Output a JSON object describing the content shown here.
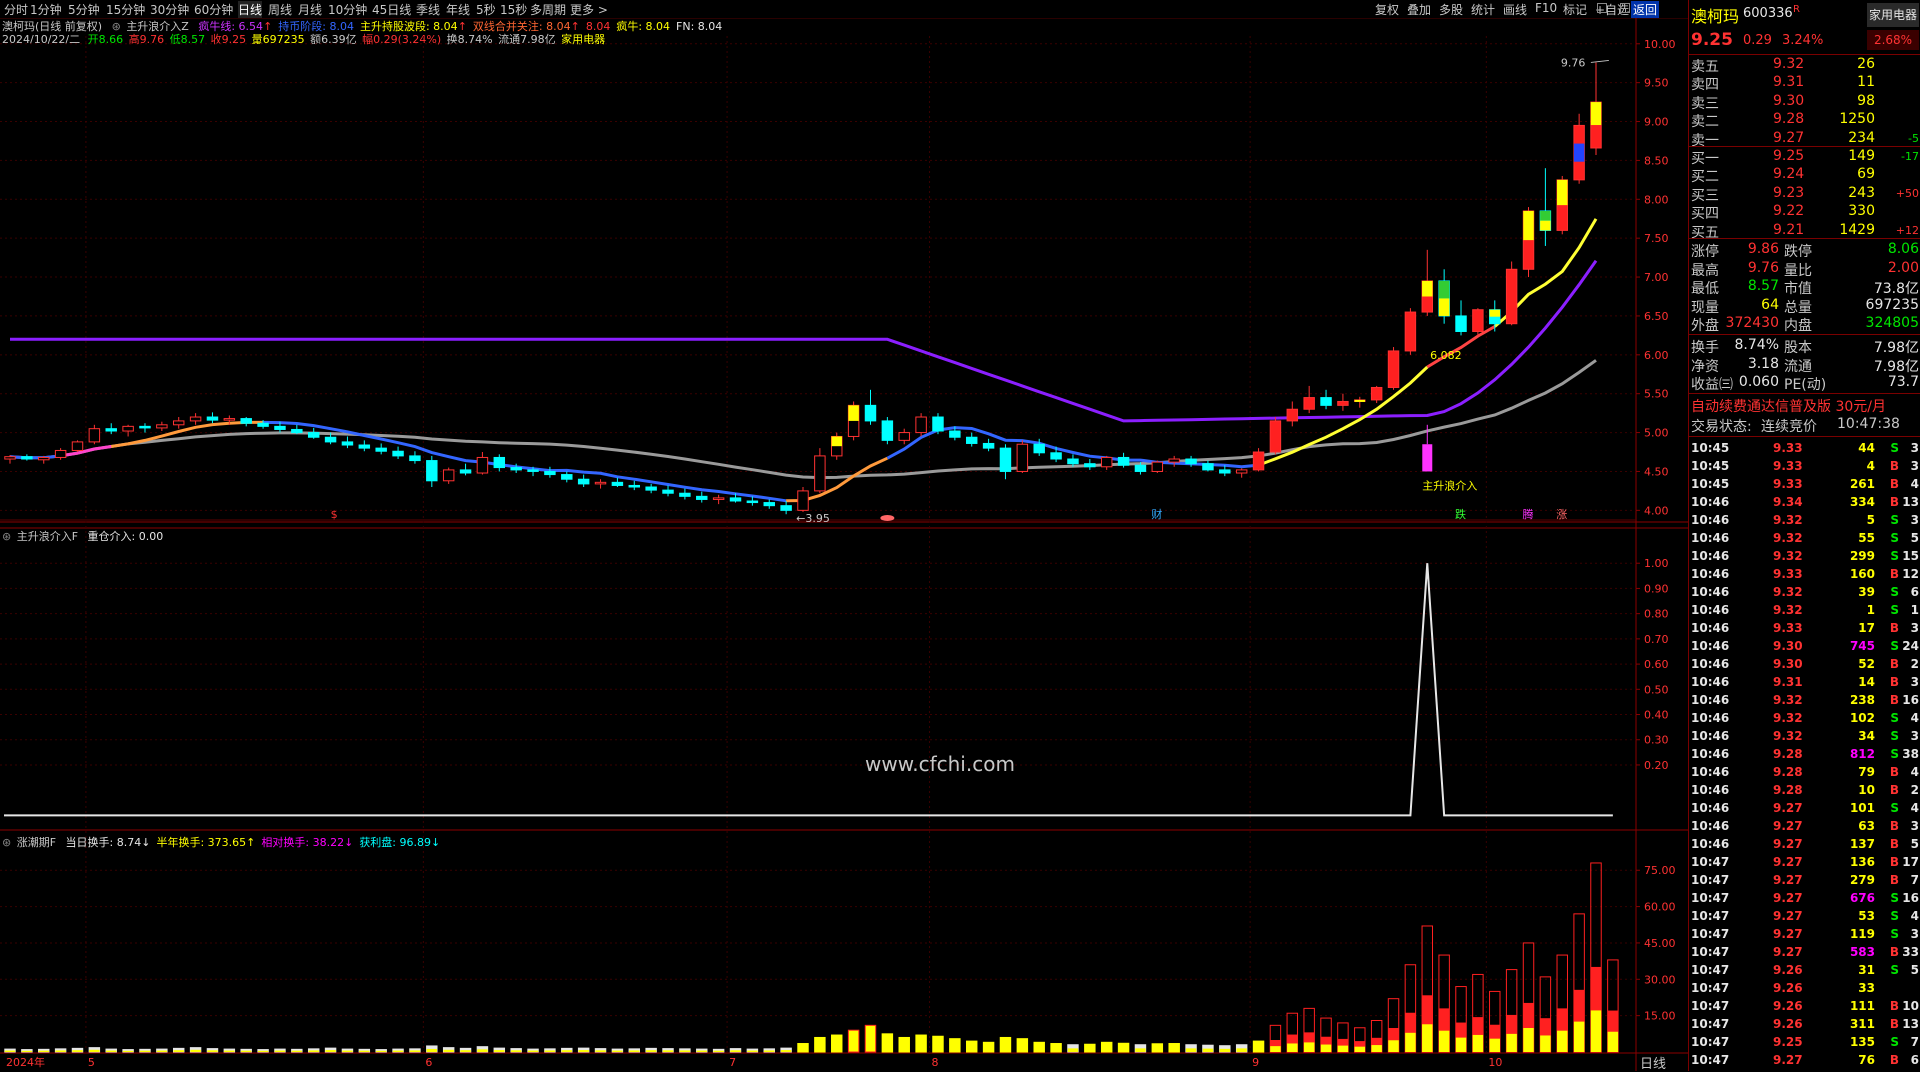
{
  "topbar": {
    "periods": [
      "分时",
      "1分钟",
      "5分钟",
      "15分钟",
      "30分钟",
      "60分钟",
      "日线",
      "周线",
      "月线",
      "10分钟",
      "45日线",
      "季线",
      "年线",
      "5秒",
      "15秒",
      "多周期",
      "更多 >"
    ],
    "active_period": "日线",
    "right_buttons": [
      "复权",
      "叠加",
      "多股",
      "统计",
      "画线",
      "F10",
      "标记",
      "+自选",
      "返回"
    ]
  },
  "main_legend": {
    "stock_title": "澳柯玛(日线 前复权)",
    "indicator_name": "主升浪介入Z",
    "items": [
      {
        "label": "疯牛线: 6.54",
        "color": "#cc33ff"
      },
      {
        "label": "持币阶段: 8.04",
        "color": "#3366ff"
      },
      {
        "label": "主升持股波段: 8.04",
        "color": "#ffff00"
      },
      {
        "label": "双线合并关注: 8.04",
        "color": "#ff6633"
      },
      {
        "label": "8.04",
        "color": "#ff3232"
      },
      {
        "label": "疯牛: 8.04",
        "color": "#ffff00"
      },
      {
        "label": "FN: 8.04",
        "color": "#e6e6e6"
      }
    ]
  },
  "quote_line": {
    "date": "2024/10/22/二",
    "open": "开8.66",
    "high": "高9.76",
    "low": "低8.57",
    "close": "收9.25",
    "vol": "量697235",
    "amount": "额6.39亿",
    "amp": "幅0.29(3.24%)",
    "turnover": "换8.74%",
    "float_cap": "流通7.98亿",
    "sector": "家用电器"
  },
  "chart_data": [
    {
      "type": "candlestick",
      "title": "澳柯玛(日线 前复权)",
      "y_ticks": [
        "10.00",
        "9.50",
        "9.00",
        "8.50",
        "8.00",
        "7.50",
        "7.00",
        "6.50",
        "6.00",
        "5.50",
        "5.00",
        "4.50",
        "4.00"
      ],
      "ylim": [
        3.85,
        10.1
      ],
      "annotations": [
        "9.76",
        "3.95",
        "6.082",
        "主升浪介入"
      ],
      "markers": [
        "$",
        "财",
        "跌",
        "腾",
        "涨"
      ],
      "x_month_labels": [
        "2024年",
        "5",
        "6",
        "7",
        "8",
        "9",
        "10"
      ],
      "candles": [
        [
          4.66,
          4.71,
          4.6,
          4.69
        ],
        [
          4.69,
          4.72,
          4.64,
          4.66
        ],
        [
          4.65,
          4.7,
          4.6,
          4.68
        ],
        [
          4.68,
          4.8,
          4.65,
          4.77
        ],
        [
          4.77,
          4.9,
          4.75,
          4.88
        ],
        [
          4.88,
          5.1,
          4.85,
          5.05
        ],
        [
          5.05,
          5.12,
          4.98,
          5.02
        ],
        [
          5.02,
          5.1,
          4.95,
          5.08
        ],
        [
          5.08,
          5.12,
          5.0,
          5.06
        ],
        [
          5.06,
          5.14,
          5.02,
          5.1
        ],
        [
          5.1,
          5.2,
          5.05,
          5.15
        ],
        [
          5.15,
          5.25,
          5.1,
          5.2
        ],
        [
          5.2,
          5.26,
          5.12,
          5.16
        ],
        [
          5.16,
          5.22,
          5.1,
          5.18
        ],
        [
          5.18,
          5.2,
          5.08,
          5.12
        ],
        [
          5.12,
          5.16,
          5.05,
          5.08
        ],
        [
          5.08,
          5.14,
          5.0,
          5.04
        ],
        [
          5.04,
          5.1,
          4.98,
          5.0
        ],
        [
          5.0,
          5.06,
          4.92,
          4.94
        ],
        [
          4.94,
          5.0,
          4.85,
          4.88
        ],
        [
          4.88,
          4.95,
          4.8,
          4.84
        ],
        [
          4.84,
          4.9,
          4.76,
          4.8
        ],
        [
          4.8,
          4.86,
          4.72,
          4.76
        ],
        [
          4.76,
          4.82,
          4.66,
          4.7
        ],
        [
          4.7,
          4.76,
          4.6,
          4.64
        ],
        [
          4.64,
          4.7,
          4.3,
          4.38
        ],
        [
          4.38,
          4.55,
          4.34,
          4.52
        ],
        [
          4.52,
          4.6,
          4.45,
          4.48
        ],
        [
          4.48,
          4.75,
          4.46,
          4.68
        ],
        [
          4.68,
          4.72,
          4.5,
          4.55
        ],
        [
          4.55,
          4.6,
          4.48,
          4.52
        ],
        [
          4.52,
          4.56,
          4.44,
          4.5
        ],
        [
          4.5,
          4.56,
          4.42,
          4.46
        ],
        [
          4.46,
          4.5,
          4.36,
          4.4
        ],
        [
          4.4,
          4.46,
          4.3,
          4.34
        ],
        [
          4.34,
          4.4,
          4.28,
          4.36
        ],
        [
          4.36,
          4.42,
          4.3,
          4.32
        ],
        [
          4.32,
          4.38,
          4.26,
          4.3
        ],
        [
          4.3,
          4.34,
          4.22,
          4.26
        ],
        [
          4.26,
          4.32,
          4.18,
          4.22
        ],
        [
          4.22,
          4.28,
          4.14,
          4.18
        ],
        [
          4.18,
          4.24,
          4.1,
          4.14
        ],
        [
          4.14,
          4.2,
          4.08,
          4.16
        ],
        [
          4.16,
          4.22,
          4.1,
          4.12
        ],
        [
          4.12,
          4.18,
          4.06,
          4.1
        ],
        [
          4.1,
          4.14,
          4.02,
          4.06
        ],
        [
          4.06,
          4.12,
          3.95,
          4.0
        ],
        [
          4.0,
          4.3,
          3.98,
          4.25
        ],
        [
          4.25,
          4.8,
          4.22,
          4.7
        ],
        [
          4.7,
          5.0,
          4.65,
          4.95
        ],
        [
          4.95,
          5.4,
          4.9,
          5.35
        ],
        [
          5.35,
          5.55,
          5.1,
          5.15
        ],
        [
          5.15,
          5.2,
          4.85,
          4.9
        ],
        [
          4.9,
          5.05,
          4.85,
          5.0
        ],
        [
          5.0,
          5.25,
          4.95,
          5.2
        ],
        [
          5.2,
          5.25,
          4.98,
          5.02
        ],
        [
          5.02,
          5.08,
          4.9,
          4.94
        ],
        [
          4.94,
          5.0,
          4.82,
          4.86
        ],
        [
          4.86,
          4.92,
          4.76,
          4.8
        ],
        [
          4.8,
          4.85,
          4.4,
          4.5
        ],
        [
          4.5,
          4.9,
          4.48,
          4.85
        ],
        [
          4.85,
          4.92,
          4.7,
          4.74
        ],
        [
          4.74,
          4.82,
          4.62,
          4.66
        ],
        [
          4.66,
          4.72,
          4.56,
          4.6
        ],
        [
          4.6,
          4.66,
          4.52,
          4.56
        ],
        [
          4.56,
          4.7,
          4.52,
          4.68
        ],
        [
          4.68,
          4.74,
          4.55,
          4.58
        ],
        [
          4.58,
          4.62,
          4.46,
          4.5
        ],
        [
          4.5,
          4.64,
          4.48,
          4.62
        ],
        [
          4.62,
          4.7,
          4.56,
          4.66
        ],
        [
          4.66,
          4.7,
          4.56,
          4.6
        ],
        [
          4.6,
          4.64,
          4.5,
          4.52
        ],
        [
          4.52,
          4.58,
          4.44,
          4.48
        ],
        [
          4.48,
          4.54,
          4.42,
          4.52
        ],
        [
          4.52,
          4.8,
          4.5,
          4.75
        ],
        [
          4.75,
          5.2,
          4.72,
          5.15
        ],
        [
          5.15,
          5.4,
          5.08,
          5.3
        ],
        [
          5.3,
          5.6,
          5.25,
          5.45
        ],
        [
          5.45,
          5.55,
          5.3,
          5.35
        ],
        [
          5.35,
          5.5,
          5.28,
          5.4
        ],
        [
          5.4,
          5.46,
          5.32,
          5.42
        ],
        [
          5.42,
          5.6,
          5.38,
          5.58
        ],
        [
          5.58,
          6.1,
          5.55,
          6.05
        ],
        [
          6.05,
          6.6,
          6.0,
          6.55
        ],
        [
          6.55,
          7.35,
          6.5,
          6.95
        ],
        [
          6.95,
          7.1,
          6.4,
          6.5
        ],
        [
          6.5,
          6.7,
          6.25,
          6.3
        ],
        [
          6.3,
          6.6,
          6.25,
          6.58
        ],
        [
          6.58,
          6.7,
          6.3,
          6.4
        ],
        [
          6.4,
          7.2,
          6.38,
          7.1
        ],
        [
          7.1,
          7.9,
          7.0,
          7.85
        ],
        [
          7.85,
          8.4,
          7.4,
          7.6
        ],
        [
          7.6,
          8.3,
          7.55,
          8.25
        ],
        [
          8.25,
          9.1,
          8.2,
          8.95
        ],
        [
          8.66,
          9.76,
          8.57,
          9.25
        ]
      ]
    },
    {
      "type": "line",
      "title": "主升浪介入F",
      "legend": "重仓介入: 0.00",
      "y_ticks": [
        "1.00",
        "0.90",
        "0.80",
        "0.70",
        "0.60",
        "0.50",
        "0.40",
        "0.30",
        "0.20"
      ],
      "ylim": [
        -0.05,
        1.1
      ],
      "series": [
        {
          "name": "重仓介入",
          "spike_index": 84,
          "values": [
            0,
            1,
            0
          ]
        }
      ]
    },
    {
      "type": "bar",
      "title": "涨潮期F",
      "legend": [
        {
          "label": "当日换手: 8.74↓",
          "color": "#e6e6e6"
        },
        {
          "label": "半年换手: 373.65↑",
          "color": "#ffff00"
        },
        {
          "label": "相对换手: 38.22↓",
          "color": "#ff00ff"
        },
        {
          "label": "获利盘: 96.89↓",
          "color": "#00ffff"
        }
      ],
      "y_ticks": [
        "75.00",
        "60.00",
        "45.00",
        "30.00",
        "15.00"
      ],
      "ylim": [
        0,
        85
      ],
      "values": [
        1.2,
        1.0,
        1.1,
        1.3,
        1.5,
        1.8,
        1.2,
        1.0,
        1.1,
        1.2,
        1.5,
        1.8,
        1.4,
        1.2,
        1.1,
        1.0,
        1.2,
        1.1,
        1.3,
        1.6,
        1.2,
        1.1,
        1.0,
        1.2,
        1.3,
        2.5,
        1.8,
        1.5,
        2.2,
        1.6,
        1.4,
        1.2,
        1.3,
        1.5,
        1.6,
        1.4,
        1.2,
        1.3,
        1.5,
        1.4,
        1.3,
        1.2,
        1.1,
        1.4,
        1.2,
        1.3,
        1.6,
        3.5,
        6.0,
        7.0,
        9.0,
        11.0,
        7.5,
        6.0,
        7.0,
        6.5,
        5.5,
        4.5,
        4.0,
        6.0,
        5.5,
        4.0,
        3.5,
        3.0,
        3.2,
        4.0,
        3.6,
        3.0,
        3.4,
        3.5,
        3.0,
        2.8,
        2.6,
        3.0,
        4.5,
        11.0,
        16.0,
        18.0,
        14.0,
        12.0,
        10.0,
        13.0,
        22.0,
        36.0,
        52.0,
        40.0,
        27.0,
        32.0,
        25.0,
        34.0,
        45.0,
        31.0,
        40.0,
        57.0,
        78.0,
        38.0
      ]
    }
  ],
  "x_bottom_labels": [
    "2024年",
    "5",
    "6",
    "7",
    "8",
    "9",
    "10"
  ],
  "period_footer": "日线",
  "watermark": "www.cfchi.com",
  "right_panel": {
    "name": "澳柯玛",
    "code": "600336",
    "flag": "R",
    "sector_btn": "家用电器",
    "price": "9.25",
    "change": "0.29",
    "pct": "3.24%",
    "pct_badge": "2.68%",
    "asks": [
      {
        "label": "卖五",
        "price": "9.32",
        "vol": "26",
        "delta": ""
      },
      {
        "label": "卖四",
        "price": "9.31",
        "vol": "11",
        "delta": ""
      },
      {
        "label": "卖三",
        "price": "9.30",
        "vol": "98",
        "delta": ""
      },
      {
        "label": "卖二",
        "price": "9.28",
        "vol": "1250",
        "delta": ""
      },
      {
        "label": "卖一",
        "price": "9.27",
        "vol": "234",
        "delta": "-5"
      }
    ],
    "bids": [
      {
        "label": "买一",
        "price": "9.25",
        "vol": "149",
        "delta": "-17"
      },
      {
        "label": "买二",
        "price": "9.24",
        "vol": "69",
        "delta": ""
      },
      {
        "label": "买三",
        "price": "9.23",
        "vol": "243",
        "delta": "+50"
      },
      {
        "label": "买四",
        "price": "9.22",
        "vol": "330",
        "delta": ""
      },
      {
        "label": "买五",
        "price": "9.21",
        "vol": "1429",
        "delta": "+12"
      }
    ],
    "stats1": [
      {
        "l1": "涨停",
        "v1": "9.86",
        "c1": "red",
        "l2": "跌停",
        "v2": "8.06",
        "c2": "green"
      },
      {
        "l1": "最高",
        "v1": "9.76",
        "c1": "red",
        "l2": "量比",
        "v2": "2.00",
        "c2": "red"
      },
      {
        "l1": "最低",
        "v1": "8.57",
        "c1": "green",
        "l2": "市值",
        "v2": "73.8亿",
        "c2": "white"
      },
      {
        "l1": "现量",
        "v1": "64",
        "c1": "yellow",
        "l2": "总量",
        "v2": "697235",
        "c2": "white"
      },
      {
        "l1": "外盘",
        "v1": "372430",
        "c1": "red",
        "l2": "内盘",
        "v2": "324805",
        "c2": "green"
      }
    ],
    "stats2": [
      {
        "l1": "换手",
        "v1": "8.74%",
        "l2": "股本",
        "v2": "7.98亿"
      },
      {
        "l1": "净资",
        "v1": "3.18",
        "l2": "流通",
        "v2": "7.98亿"
      },
      {
        "l1": "收益㈢",
        "v1": "0.060",
        "l2": "PE(动)",
        "v2": "73.7"
      }
    ],
    "promo": "自动续费通达信普及版  30元/月",
    "status_label": "交易状态:",
    "status_value": "连续竞价",
    "status_time": "10:47:38",
    "ticks": [
      [
        "10:45",
        "9.33",
        "44",
        "S",
        "3"
      ],
      [
        "10:45",
        "9.33",
        "4",
        "B",
        "3"
      ],
      [
        "10:45",
        "9.33",
        "261",
        "B",
        "4"
      ],
      [
        "10:46",
        "9.34",
        "334",
        "B",
        "13"
      ],
      [
        "10:46",
        "9.32",
        "5",
        "S",
        "3"
      ],
      [
        "10:46",
        "9.32",
        "55",
        "S",
        "5"
      ],
      [
        "10:46",
        "9.32",
        "299",
        "S",
        "15"
      ],
      [
        "10:46",
        "9.33",
        "160",
        "B",
        "12"
      ],
      [
        "10:46",
        "9.32",
        "39",
        "S",
        "6"
      ],
      [
        "10:46",
        "9.32",
        "1",
        "S",
        "1"
      ],
      [
        "10:46",
        "9.33",
        "17",
        "B",
        "3"
      ],
      [
        "10:46",
        "9.30",
        "745",
        "S",
        "24"
      ],
      [
        "10:46",
        "9.30",
        "52",
        "B",
        "2"
      ],
      [
        "10:46",
        "9.31",
        "14",
        "B",
        "3"
      ],
      [
        "10:46",
        "9.32",
        "238",
        "B",
        "16"
      ],
      [
        "10:46",
        "9.32",
        "102",
        "S",
        "4"
      ],
      [
        "10:46",
        "9.32",
        "34",
        "S",
        "3"
      ],
      [
        "10:46",
        "9.28",
        "812",
        "S",
        "38"
      ],
      [
        "10:46",
        "9.28",
        "79",
        "B",
        "4"
      ],
      [
        "10:46",
        "9.28",
        "10",
        "B",
        "2"
      ],
      [
        "10:46",
        "9.27",
        "101",
        "S",
        "4"
      ],
      [
        "10:46",
        "9.27",
        "63",
        "B",
        "3"
      ],
      [
        "10:46",
        "9.27",
        "137",
        "B",
        "5"
      ],
      [
        "10:47",
        "9.27",
        "136",
        "B",
        "17"
      ],
      [
        "10:47",
        "9.27",
        "279",
        "B",
        "7"
      ],
      [
        "10:47",
        "9.27",
        "676",
        "S",
        "16"
      ],
      [
        "10:47",
        "9.27",
        "53",
        "S",
        "4"
      ],
      [
        "10:47",
        "9.27",
        "119",
        "S",
        "3"
      ],
      [
        "10:47",
        "9.27",
        "583",
        "B",
        "33"
      ],
      [
        "10:47",
        "9.26",
        "31",
        "S",
        "5"
      ],
      [
        "10:47",
        "9.26",
        "33",
        "",
        ""
      ],
      [
        "10:47",
        "9.26",
        "111",
        "B",
        "10"
      ],
      [
        "10:47",
        "9.26",
        "311",
        "B",
        "13"
      ],
      [
        "10:47",
        "9.25",
        "135",
        "S",
        "7"
      ],
      [
        "10:47",
        "9.27",
        "76",
        "B",
        "6"
      ]
    ]
  }
}
